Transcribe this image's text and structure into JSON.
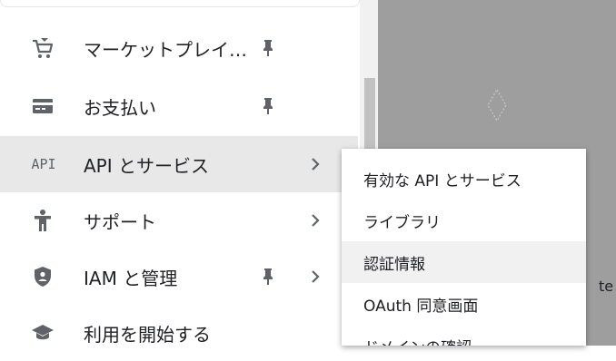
{
  "nav": {
    "items": [
      {
        "label": "マーケットプレイ…",
        "icon": "cart-icon",
        "pinned": true,
        "has_submenu": false
      },
      {
        "label": "お支払い",
        "icon": "credit-card-icon",
        "pinned": true,
        "has_submenu": false
      },
      {
        "label": "API とサービス",
        "icon": "api-icon",
        "icon_text": "API",
        "pinned": false,
        "has_submenu": true,
        "active": true
      },
      {
        "label": "サポート",
        "icon": "support-person-icon",
        "pinned": false,
        "has_submenu": true
      },
      {
        "label": "IAM と管理",
        "icon": "shield-icon",
        "pinned": true,
        "has_submenu": true
      },
      {
        "label": "利用を開始する",
        "icon": "graduation-cap-icon",
        "pinned": false,
        "has_submenu": false
      }
    ]
  },
  "submenu": {
    "items": [
      {
        "label": "有効な API とサービス"
      },
      {
        "label": "ライブラリ"
      },
      {
        "label": "認証情報",
        "hovered": true
      },
      {
        "label": "OAuth 同意画面"
      },
      {
        "label": "ドメインの確認"
      }
    ]
  },
  "background": {
    "edge_text": "te"
  },
  "colors": {
    "active_bg": "#e8e8e8",
    "overlay": "#9e9e9e",
    "icon": "#5f6368",
    "text": "#202124"
  }
}
